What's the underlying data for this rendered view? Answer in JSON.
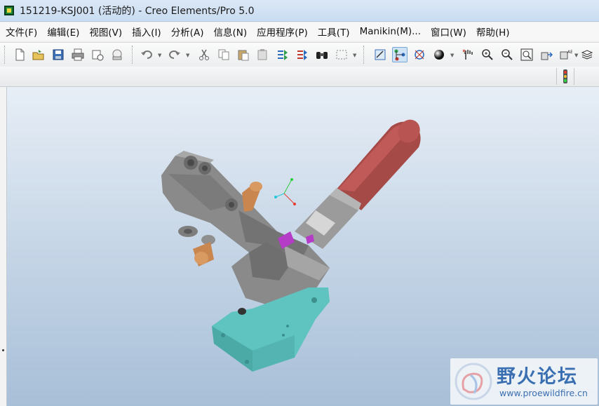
{
  "window": {
    "title": "151219-KSJ001 (活动的) - Creo Elements/Pro 5.0"
  },
  "menu": [
    "文件(F)",
    "编辑(E)",
    "视图(V)",
    "插入(I)",
    "分析(A)",
    "信息(N)",
    "应用程序(P)",
    "工具(T)",
    "Manikin(M)...",
    "窗口(W)",
    "帮助(H)"
  ],
  "toolbar": {
    "file_icons": [
      "new-file-icon",
      "open-file-icon",
      "save-icon",
      "print-icon",
      "send-mail-icon",
      "save-copy-icon"
    ],
    "edit_icons": [
      "undo-icon",
      "redo-icon",
      "cut-icon",
      "copy-icon",
      "paste-icon",
      "paste-special-icon",
      "regenerate-icon",
      "regen-manager-icon",
      "find-icon",
      "select-box-icon"
    ],
    "view_icons": [
      "repaint-icon",
      "datum-display-icon",
      "spin-center-icon",
      "shading-icon",
      "orient-mode-icon",
      "zoom-in-icon",
      "zoom-out-icon",
      "refit-icon",
      "reorient-icon",
      "saved-views-icon",
      "layers-icon"
    ],
    "status_icon": "traffic-light-icon"
  },
  "colors": {
    "handle_grip": "#b35553",
    "body": "#8a8a8a",
    "base": "#5fc3c0",
    "spindle": "#c9864f",
    "accent_part": "#b53cc6"
  },
  "watermark": {
    "title": "野火论坛",
    "url": "www.proewildfire.cn"
  }
}
